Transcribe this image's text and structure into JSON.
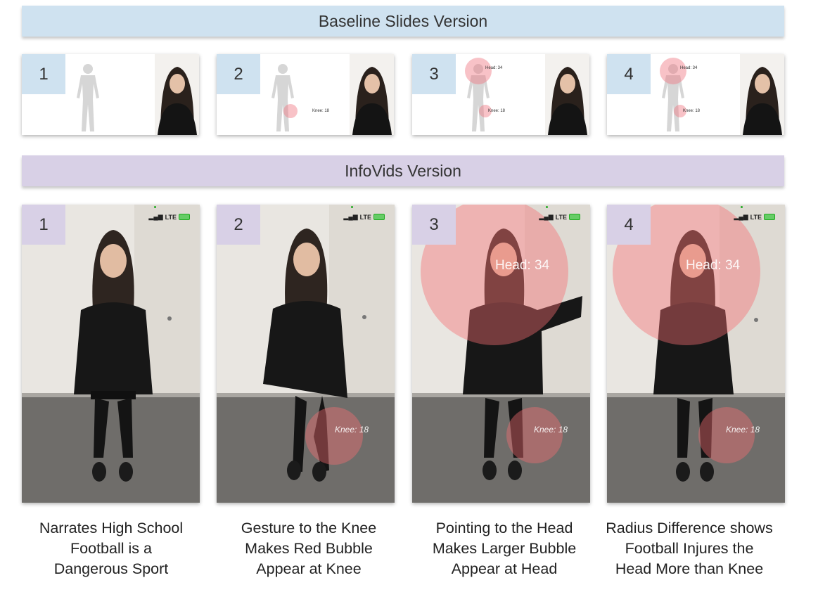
{
  "headers": {
    "baseline": "Baseline Slides Version",
    "infovids": "InfoVids Version"
  },
  "steps": [
    {
      "number": "1",
      "slide": {
        "labels": []
      },
      "video": {
        "labels": []
      },
      "caption": [
        "Narrates High School",
        "Football is a",
        "Dangerous Sport"
      ]
    },
    {
      "number": "2",
      "slide": {
        "labels": [
          "Knee: 18"
        ]
      },
      "video": {
        "labels": [
          "Knee: 18"
        ]
      },
      "caption": [
        "Gesture to the Knee",
        "Makes Red Bubble",
        "Appear at Knee"
      ]
    },
    {
      "number": "3",
      "slide": {
        "labels": [
          "Head: 34",
          "Knee: 18"
        ]
      },
      "video": {
        "labels": [
          "Head: 34",
          "Knee: 18"
        ]
      },
      "caption": [
        "Pointing to the Head",
        "Makes Larger Bubble",
        "Appear at Head"
      ]
    },
    {
      "number": "4",
      "slide": {
        "labels": [
          "Head: 34",
          "Knee: 18"
        ]
      },
      "video": {
        "labels": [
          "Head: 34",
          "Knee: 18"
        ]
      },
      "caption": [
        "Radius Difference shows",
        "Football Injures the",
        "Head More than Knee"
      ]
    }
  ],
  "phone_status": {
    "network": "LTE"
  },
  "colors": {
    "baseline_accent": "#cfe2f0",
    "infovids_accent": "#d8d0e6",
    "bubble": "#f06e73"
  }
}
